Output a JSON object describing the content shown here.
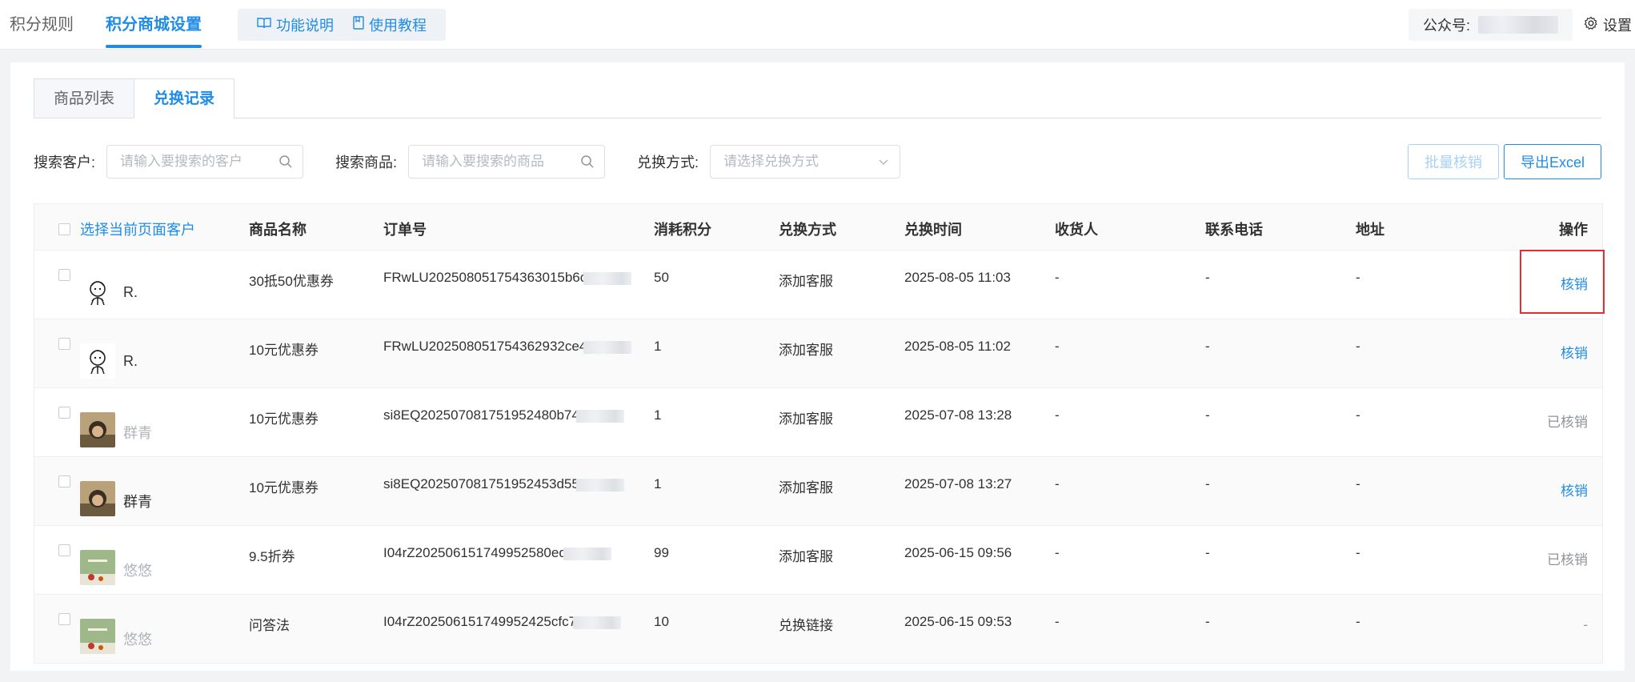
{
  "topnav": {
    "tab_rules": "积分规则",
    "tab_mall": "积分商城设置",
    "help_func": "功能说明",
    "help_tutorial": "使用教程"
  },
  "topright": {
    "account_label": "公众号:",
    "settings_label": "设置"
  },
  "tabs": {
    "goods_list": "商品列表",
    "exchange_records": "兑换记录"
  },
  "filters": {
    "customer_label": "搜索客户:",
    "customer_placeholder": "请输入要搜索的客户",
    "goods_label": "搜索商品:",
    "goods_placeholder": "请输入要搜索的商品",
    "way_label": "兑换方式:",
    "way_placeholder": "请选择兑换方式",
    "batch_btn": "批量核销",
    "export_btn": "导出Excel"
  },
  "table": {
    "headers": {
      "select_all": "选择当前页面客户",
      "name": "商品名称",
      "order": "订单号",
      "points": "消耗积分",
      "way": "兑换方式",
      "time": "兑换时间",
      "receiver": "收货人",
      "phone": "联系电话",
      "address": "地址",
      "op": "操作"
    },
    "rows": [
      {
        "customer": "R.",
        "name": "30抵50优惠券",
        "order": "FRwLU202508051754363015b6c",
        "points": "50",
        "way": "添加客服",
        "time": "2025-08-05 11:03",
        "receiver": "-",
        "phone": "-",
        "address": "-",
        "op": "核销"
      },
      {
        "customer": "R.",
        "name": "10元优惠券",
        "order": "FRwLU202508051754362932ce4",
        "points": "1",
        "way": "添加客服",
        "time": "2025-08-05 11:02",
        "receiver": "-",
        "phone": "-",
        "address": "-",
        "op": "核销"
      },
      {
        "customer": "群青",
        "name": "10元优惠券",
        "order": "si8EQ202507081751952480b74",
        "points": "1",
        "way": "添加客服",
        "time": "2025-07-08 13:28",
        "receiver": "-",
        "phone": "-",
        "address": "-",
        "op": "已核销"
      },
      {
        "customer": "群青",
        "name": "10元优惠券",
        "order": "si8EQ202507081751952453d55",
        "points": "1",
        "way": "添加客服",
        "time": "2025-07-08 13:27",
        "receiver": "-",
        "phone": "-",
        "address": "-",
        "op": "核销"
      },
      {
        "customer": "悠悠",
        "name": "9.5折券",
        "order": "I04rZ202506151749952580ed",
        "points": "99",
        "way": "添加客服",
        "time": "2025-06-15 09:56",
        "receiver": "-",
        "phone": "-",
        "address": "-",
        "op": "已核销"
      },
      {
        "customer": "悠悠",
        "name": "问答法",
        "order": "I04rZ202506151749952425cfc7",
        "points": "10",
        "way": "兑换链接",
        "time": "2025-06-15 09:53",
        "receiver": "-",
        "phone": "-",
        "address": "-",
        "op": "-"
      }
    ]
  },
  "colors": {
    "accent": "#1f8ce8",
    "highlight": "#e0302f"
  }
}
